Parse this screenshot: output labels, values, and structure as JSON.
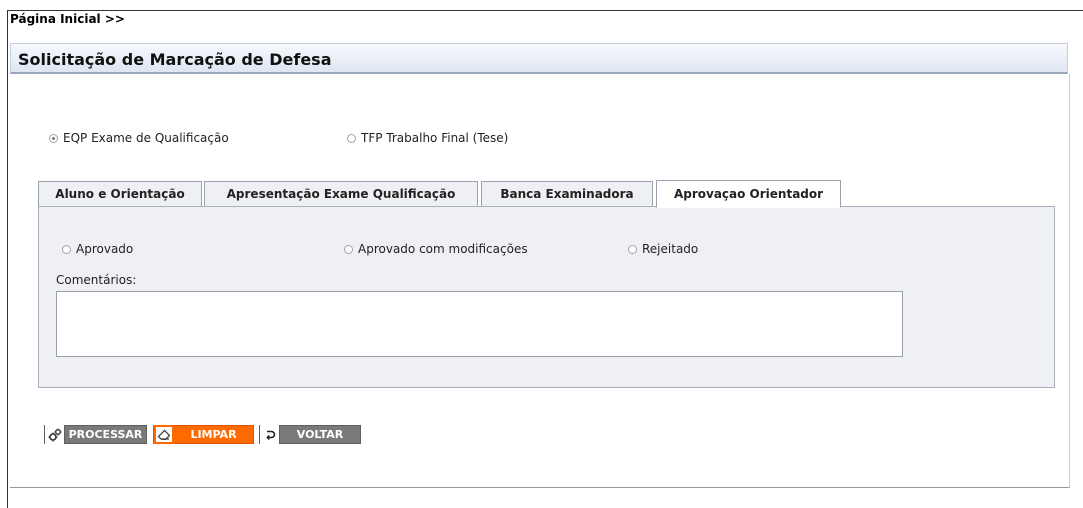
{
  "breadcrumb": "Página Inicial >>",
  "page_title": "Solicitação de Marcação de Defesa",
  "type_options": [
    {
      "label": "EQP Exame de Qualificação",
      "checked": true
    },
    {
      "label": "TFP Trabalho Final (Tese)",
      "checked": false
    }
  ],
  "tabs": [
    {
      "label": "Aluno e Orientação",
      "active": false
    },
    {
      "label": "Apresentação Exame Qualificação",
      "active": false
    },
    {
      "label": "Banca Examinadora",
      "active": false
    },
    {
      "label": "Aprovaçao Orientador",
      "active": true
    }
  ],
  "approval_options": [
    {
      "label": "Aprovado",
      "checked": false
    },
    {
      "label": "Aprovado com modificações",
      "checked": false
    },
    {
      "label": "Rejeitado",
      "checked": false
    }
  ],
  "comments_label": "Comentários:",
  "comments_value": "",
  "buttons": {
    "process": "PROCESSAR",
    "clear": "LIMPAR",
    "back": "VOLTAR"
  },
  "colors": {
    "accent_orange": "#ff6a00",
    "button_gray": "#7a7a7a",
    "panel_bg": "#eef0f4"
  }
}
